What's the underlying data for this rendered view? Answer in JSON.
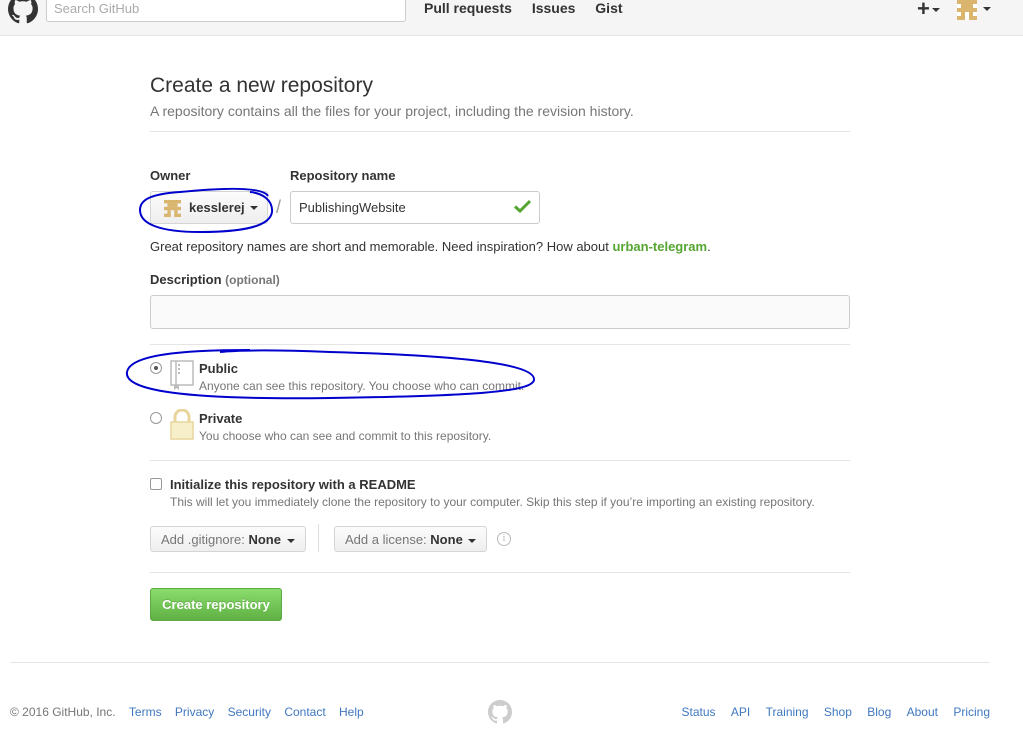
{
  "header": {
    "search_placeholder": "Search GitHub",
    "nav": [
      "Pull requests",
      "Issues",
      "Gist"
    ],
    "plus_label": "+"
  },
  "page": {
    "title": "Create a new repository",
    "subtitle": "A repository contains all the files for your project, including the revision history."
  },
  "form": {
    "owner_label": "Owner",
    "owner_value": "kesslerej",
    "repo_label": "Repository name",
    "repo_value": "PublishingWebsite",
    "slash": "/",
    "hint_prefix": "Great repository names are short and memorable. Need inspiration? How about ",
    "hint_suggestion": "urban-telegram",
    "hint_suffix": ".",
    "description_label": "Description",
    "description_optional": "(optional)",
    "description_value": "",
    "public_title": "Public",
    "public_desc": "Anyone can see this repository. You choose who can commit.",
    "private_title": "Private",
    "private_desc": "You choose who can see and commit to this repository.",
    "readme_title": "Initialize this repository with a README",
    "readme_desc": "This will let you immediately clone the repository to your computer. Skip this step if you’re importing an existing repository.",
    "gitignore_prefix": "Add .gitignore:",
    "gitignore_value": "None",
    "license_prefix": "Add a license:",
    "license_value": "None",
    "create_label": "Create repository",
    "visibility_selected": "public",
    "readme_checked": false
  },
  "footer": {
    "copyright": "© 2016 GitHub, Inc.",
    "left_links": [
      "Terms",
      "Privacy",
      "Security",
      "Contact",
      "Help"
    ],
    "right_links": [
      "Status",
      "API",
      "Training",
      "Shop",
      "Blog",
      "About",
      "Pricing"
    ]
  },
  "colors": {
    "link": "#4078c0",
    "create_button": "#60b044",
    "suggestion": "#55a532",
    "annotation": "#0000cc"
  }
}
